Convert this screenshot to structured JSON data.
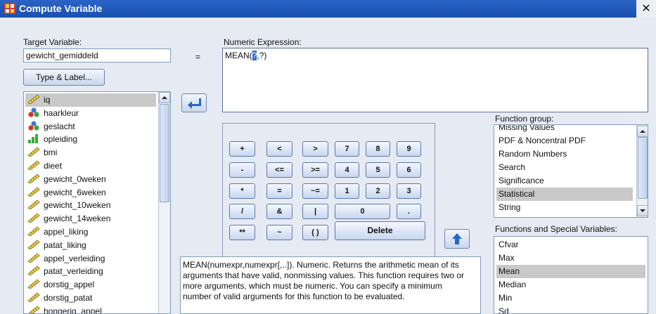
{
  "window": {
    "title": "Compute Variable",
    "close_glyph": "✕"
  },
  "target": {
    "label": "Target Variable:",
    "value": "gewicht_gemiddeld",
    "equals": "="
  },
  "type_label_button": "Type & Label...",
  "expression": {
    "label": "Numeric Expression:",
    "prefix": "MEAN(",
    "selected": "?",
    "suffix": ",?)"
  },
  "variables": [
    {
      "name": "iq",
      "icon": "ruler-icon",
      "selected": true
    },
    {
      "name": "haarkleur",
      "icon": "nominal-icon"
    },
    {
      "name": "geslacht",
      "icon": "nominal-icon"
    },
    {
      "name": "opleiding",
      "icon": "ordinal-icon"
    },
    {
      "name": "bmi",
      "icon": "ruler-icon"
    },
    {
      "name": "dieet",
      "icon": "ruler-icon"
    },
    {
      "name": "gewicht_0weken",
      "icon": "ruler-icon"
    },
    {
      "name": "gewicht_6weken",
      "icon": "ruler-icon"
    },
    {
      "name": "gewicht_10weken",
      "icon": "ruler-icon"
    },
    {
      "name": "gewicht_14weken",
      "icon": "ruler-icon"
    },
    {
      "name": "appel_liking",
      "icon": "ruler-icon"
    },
    {
      "name": "patat_liking",
      "icon": "ruler-icon"
    },
    {
      "name": "appel_verleiding",
      "icon": "ruler-icon"
    },
    {
      "name": "patat_verleiding",
      "icon": "ruler-icon"
    },
    {
      "name": "dorstig_appel",
      "icon": "ruler-icon"
    },
    {
      "name": "dorstig_patat",
      "icon": "ruler-icon"
    },
    {
      "name": "hongerig_appel",
      "icon": "ruler-icon"
    }
  ],
  "keypad": {
    "ops": [
      [
        "+",
        "<",
        ">"
      ],
      [
        "-",
        "<=",
        ">="
      ],
      [
        "*",
        "=",
        "~="
      ],
      [
        "/",
        "&",
        "|"
      ],
      [
        "**",
        "~",
        "( )"
      ]
    ],
    "digits": [
      [
        "7",
        "8",
        "9"
      ],
      [
        "4",
        "5",
        "6"
      ],
      [
        "1",
        "2",
        "3"
      ]
    ],
    "zero": "0",
    "dot": ".",
    "delete": "Delete"
  },
  "function_group": {
    "label": "Function group:",
    "items": [
      "Missing Values",
      "PDF & Noncentral PDF",
      "Random Numbers",
      "Search",
      "Significance",
      "Statistical",
      "String"
    ],
    "selected": "Statistical"
  },
  "functions": {
    "label": "Functions and Special Variables:",
    "items": [
      "Cfvar",
      "Max",
      "Mean",
      "Median",
      "Min",
      "Sd"
    ],
    "selected": "Mean"
  },
  "description": "MEAN(numexpr,numexpr[,..]). Numeric. Returns the arithmetic mean of its arguments that have valid, nonmissing values. This function requires two or more arguments, which must be numeric. You can specify a minimum number of valid arguments for this function to be evaluated.",
  "colors": {
    "title_bar": "#1a4fae",
    "selection": "#c9c9c9",
    "highlight": "#2a6bd6",
    "arrow_blue": "#2468c8"
  }
}
